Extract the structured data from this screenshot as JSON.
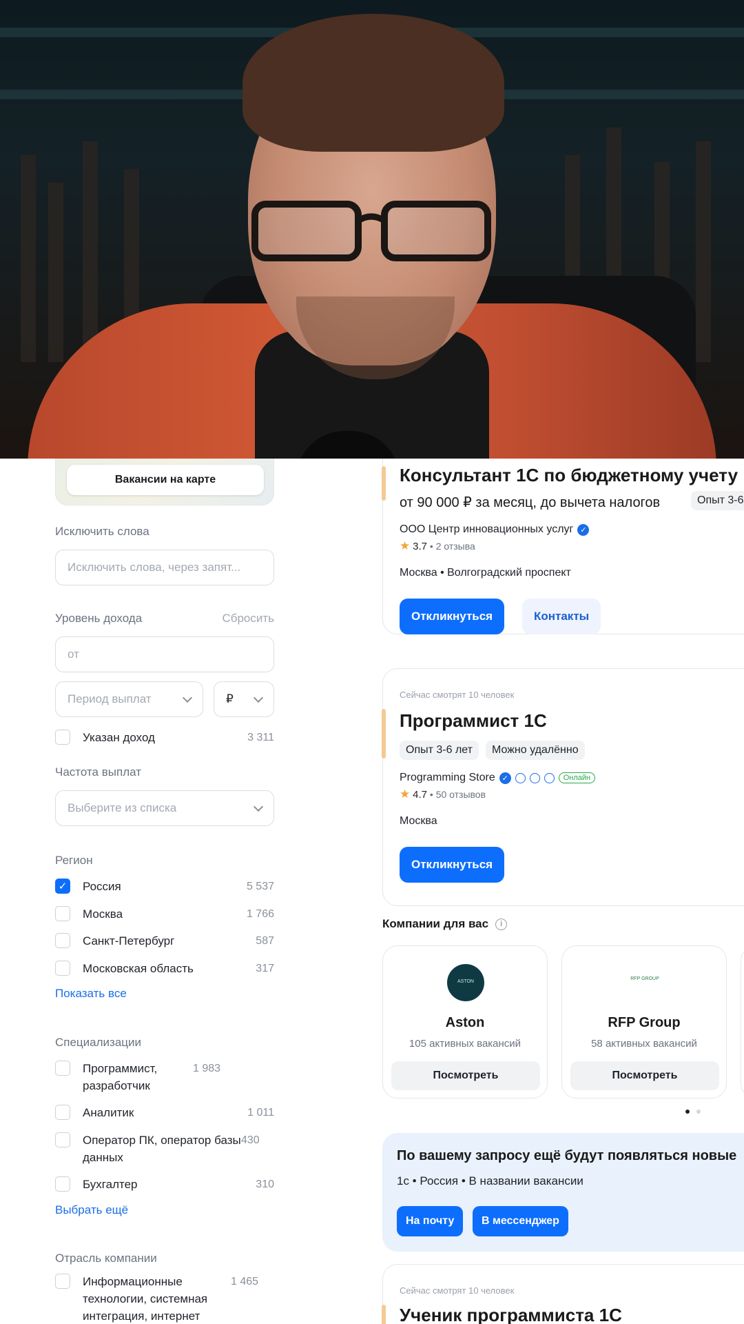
{
  "filters": {
    "map_button": "Вакансии на карте",
    "exclude": {
      "label": "Исключить слова",
      "placeholder": "Исключить слова, через запят..."
    },
    "income": {
      "label": "Уровень дохода",
      "reset": "Сбросить",
      "from_placeholder": "от",
      "period_placeholder": "Период выплат",
      "currency": "₽",
      "specified": {
        "label": "Указан доход",
        "count": "3 311"
      }
    },
    "frequency": {
      "label": "Частота выплат",
      "placeholder": "Выберите из списка"
    },
    "region": {
      "label": "Регион",
      "items": [
        {
          "label": "Россия",
          "count": "5 537",
          "checked": true
        },
        {
          "label": "Москва",
          "count": "1 766",
          "checked": false
        },
        {
          "label": "Санкт-Петербург",
          "count": "587",
          "checked": false
        },
        {
          "label": "Московская область",
          "count": "317",
          "checked": false
        }
      ],
      "show_all": "Показать все"
    },
    "specializations": {
      "label": "Специализации",
      "items": [
        {
          "label": "Программист, разработчик",
          "count": "1 983"
        },
        {
          "label": "Аналитик",
          "count": "1 011"
        },
        {
          "label": "Оператор ПК, оператор базы данных",
          "count": "430"
        },
        {
          "label": "Бухгалтер",
          "count": "310"
        }
      ],
      "more": "Выбрать ещё"
    },
    "industry": {
      "label": "Отрасль компании",
      "items": [
        {
          "label": "Информационные технологии, системная интеграция, интернет",
          "count": "1 465"
        }
      ]
    }
  },
  "results": {
    "vacancy1": {
      "title": "Консультант 1С по бюджетному учету",
      "salary": "от 90 000 ₽ за месяц, до вычета налогов",
      "experience_chip": "Опыт 3-6",
      "company": "ООО Центр инновационных услуг",
      "rating": "3.7",
      "reviews": "2 отзыва",
      "location": "Москва  •  Волгоградский проспект",
      "apply": "Откликнуться",
      "contacts": "Контакты"
    },
    "vacancy2": {
      "watching": "Сейчас смотрят 10 человек",
      "title": "Программист 1С",
      "chips": [
        "Опыт 3-6 лет",
        "Можно удалённо"
      ],
      "company": "Programming Store",
      "online": "Онлайн",
      "rating": "4.7",
      "reviews": "50 отзывов",
      "location": "Москва",
      "apply": "Откликнуться"
    },
    "companies": {
      "title": "Компании для вас",
      "items": [
        {
          "name": "Aston",
          "count": "105 активных вакансий",
          "button": "Посмотреть",
          "logo_text": "ASTON"
        },
        {
          "name": "RFP Group",
          "count": "58 активных вакансий",
          "button": "Посмотреть",
          "logo_text": "RFP GROUP"
        }
      ]
    },
    "subscription": {
      "title": "По вашему запросу ещё будут появляться новые",
      "query": "1с • Россия • В названии вакансии",
      "email_button": "На почту",
      "messenger_button": "В мессенджер"
    },
    "vacancy3": {
      "watching": "Сейчас смотрят 10 человек",
      "title": "Ученик программиста 1С"
    }
  },
  "colors": {
    "primary": "#0d6efd",
    "accent_bar": "#f5c994",
    "link": "#1a6ee8",
    "subscription_bg": "#e9f1fc"
  }
}
